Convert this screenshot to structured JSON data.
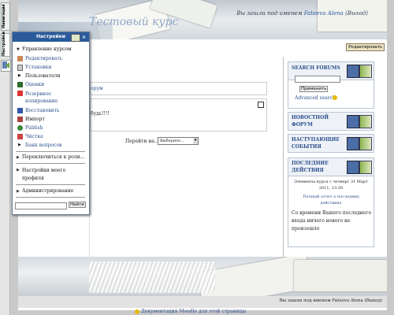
{
  "dock": {
    "nav_tab": "Навигация",
    "settings_tab": "Настройки"
  },
  "header": {
    "course_title": "Тестовый курс",
    "login_prefix": "Вы зашли под именем",
    "user": "Fateeva Alena",
    "logout": "(Выход)"
  },
  "toolbar": {
    "edit_button": "Редактировать"
  },
  "center": {
    "forum_fragment": "орум",
    "text_fragment": "будь!!!!",
    "jump_label": "Перейти на...",
    "jump_select": "Выберите..."
  },
  "settings_panel": {
    "title": "Настройки",
    "section_course": "Управление курсом",
    "items": [
      {
        "label": "Редактировать",
        "icon": "edit-icon"
      },
      {
        "label": "Установки",
        "icon": "settings-icon"
      },
      {
        "label": "Пользователи",
        "icon": "users-icon"
      },
      {
        "label": "Оценки",
        "icon": "grades-icon"
      },
      {
        "label": "Резервное",
        "label2": "копирование",
        "icon": "backup-icon"
      },
      {
        "label": "Восстановить",
        "icon": "restore-icon"
      },
      {
        "label": "Импорт",
        "icon": "import-icon"
      },
      {
        "label": "Publish",
        "icon": "publish-icon"
      },
      {
        "label": "Чистка",
        "icon": "reset-icon"
      },
      {
        "label": "Банк вопросов",
        "icon": "question-bank-icon"
      }
    ],
    "switch_role": "Переключиться к роли...",
    "profile_line1": "Настройки моего",
    "profile_line2": "профиля",
    "admin": "Администрирование",
    "search_button": "Найти"
  },
  "blocks": {
    "search": {
      "title": "SEARCH FORUMS",
      "button": "Применить",
      "advanced": "Advanced search"
    },
    "news": {
      "title_line1": "НОВОСТНОЙ",
      "title_line2": "ФОРУМ"
    },
    "events": {
      "title_line1": "НАСТУПАЮЩИЕ",
      "title_line2": "СОБЫТИЯ"
    },
    "recent": {
      "title_line1": "ПОСЛЕДНИЕ",
      "title_line2": "ДЕЙСТВИЯ",
      "since_line1": "Элементы курса с четверг 31 Март",
      "since_line2": "2011, 13:30",
      "report_line1": "Полный отчет о последних",
      "report_line2": "действиях",
      "nothing_line1": "Со времени Вашего последнего",
      "nothing_line2": "входа ничего нового не",
      "nothing_line3": "произошло"
    }
  },
  "footer": {
    "login_text": "Вы зашли под именем Fateeva Alena (Выход)",
    "doc_link": "Документация Moodle для этой страницы"
  },
  "colors": {
    "accent": "#2a5a9a",
    "link": "#2a4f8c",
    "edit_button_bg": "#ece2c4"
  }
}
